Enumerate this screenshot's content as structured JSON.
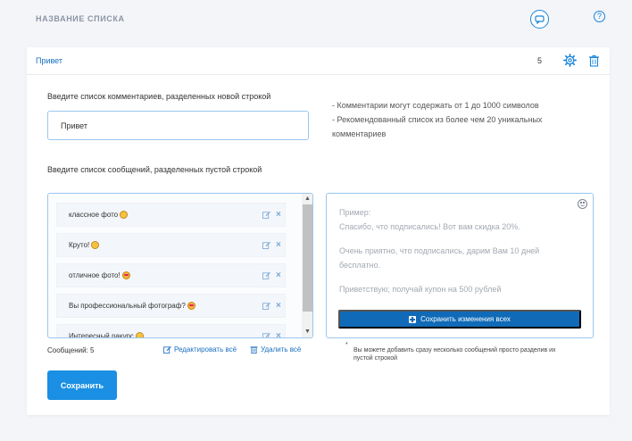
{
  "header": {
    "title": "НАЗВАНИЕ СПИСКА"
  },
  "list": {
    "name": "Привет",
    "count": "5"
  },
  "comments": {
    "label": "Введите список комментариев, разделенных новой строкой",
    "value": "Привет",
    "hints": [
      "- Комментарии могут содержать от 1 до 1000 символов",
      "- Рекомендованный список из более чем 20 уникальных комментариев"
    ]
  },
  "messages": {
    "label": "Введите список сообщений, разделенных пустой строкой",
    "items": [
      {
        "text": "классное фото",
        "emoji": "smile"
      },
      {
        "text": "Круто!",
        "emoji": "smile"
      },
      {
        "text": "отличное фото!",
        "emoji": "heart-eyes"
      },
      {
        "text": "Вы профессиональный фотограф?",
        "emoji": "heart-eyes"
      },
      {
        "text": "Интересный ракурс",
        "emoji": "smile"
      }
    ],
    "count_label": "Сообщений: 5",
    "edit_all": "Редактировать всё",
    "delete_all": "Удалить всё"
  },
  "preview": {
    "title": "Пример:",
    "lines": [
      "Спасибо, что подписались! Вот вам скидка 20%.",
      "Очень приятно, что подписались, дарим Вам 10 дней бесплатно.",
      "Приветствую; получай купон на 500 рублей"
    ],
    "save_all_label": "Сохранить изменения всех"
  },
  "footnote": {
    "mark": "*",
    "text": "Вы можете добавить сразу несколько сообщений просто разделив их пустой строкой"
  },
  "save_label": "Сохранить",
  "colors": {
    "accent": "#1a84d8",
    "primary_button": "#1a8fe3",
    "dark_button": "#106ab7",
    "page_background": "#f3f5f9"
  }
}
